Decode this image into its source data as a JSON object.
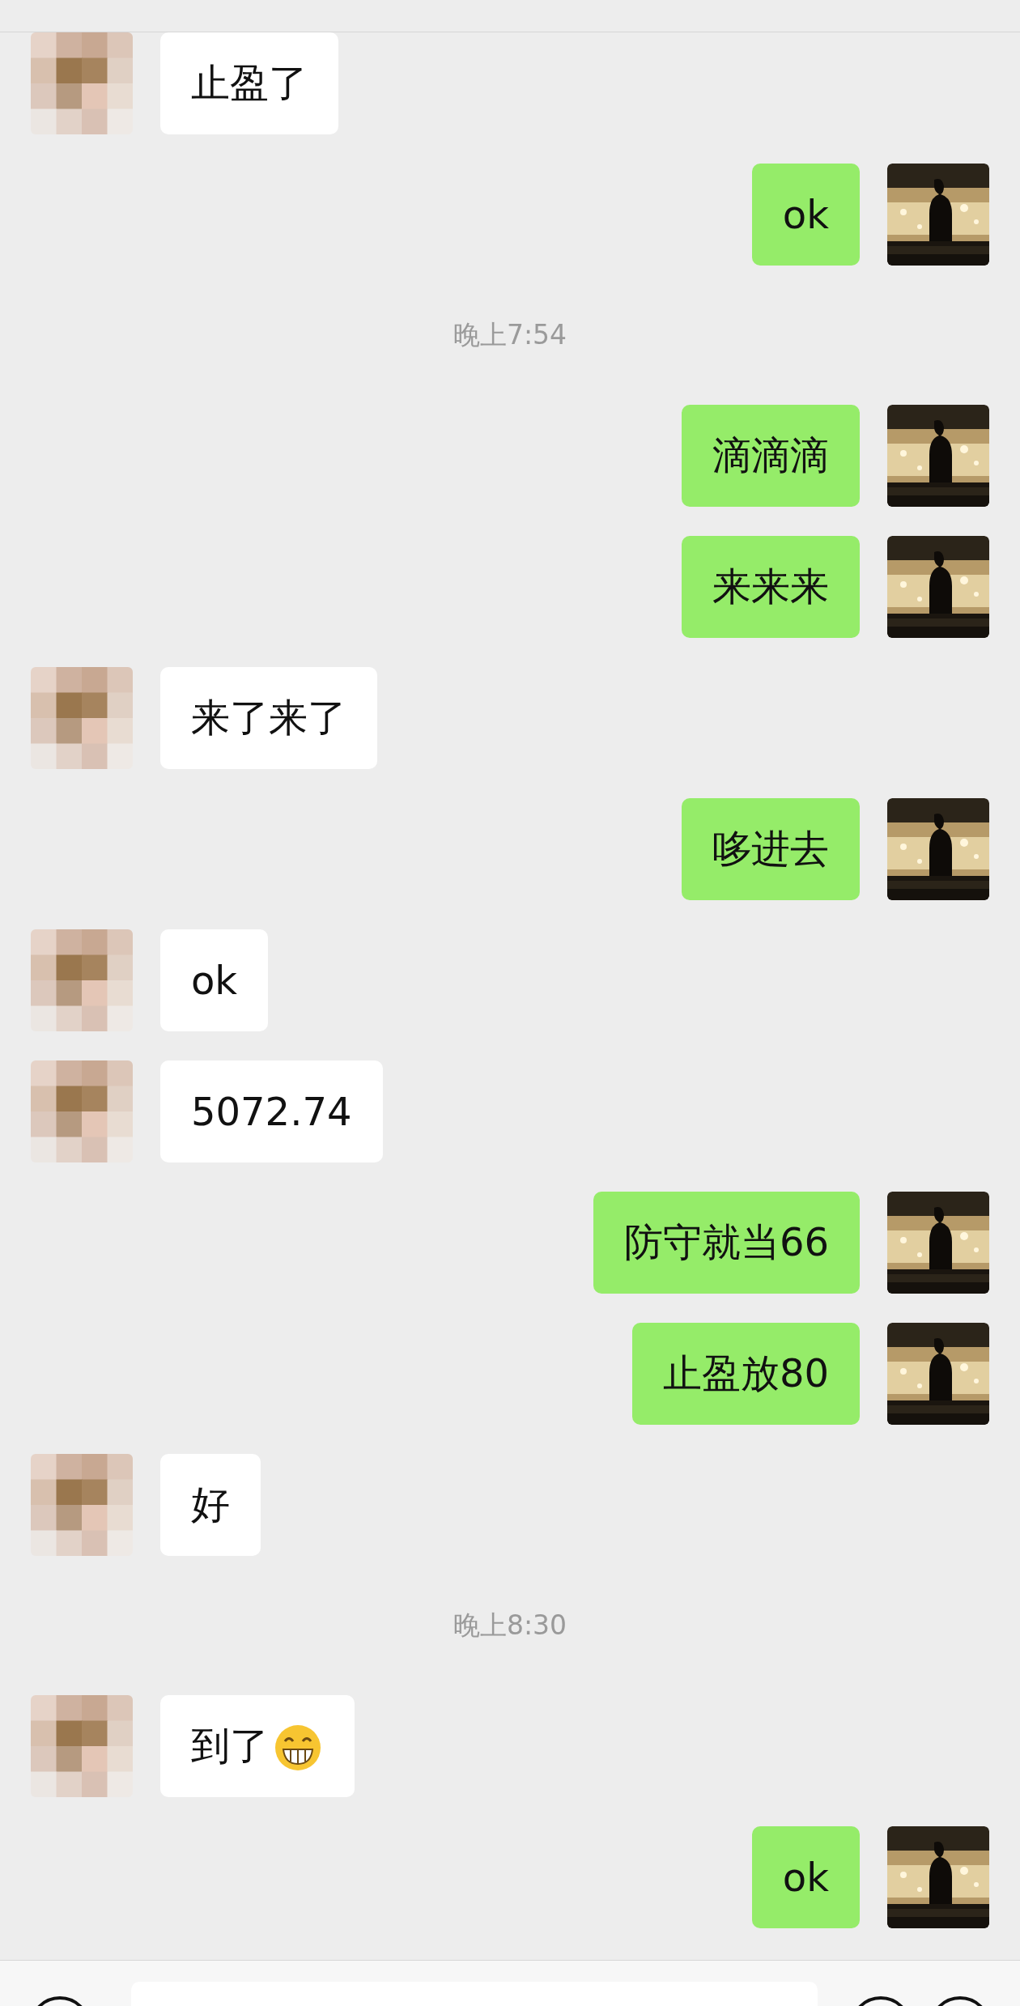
{
  "messages": [
    {
      "kind": "received",
      "text": "止盈了"
    },
    {
      "kind": "sent",
      "text": "ok"
    },
    {
      "kind": "time",
      "text": "晚上7:54"
    },
    {
      "kind": "sent",
      "text": "滴滴滴"
    },
    {
      "kind": "sent",
      "text": "来来来"
    },
    {
      "kind": "received",
      "text": "来了来了"
    },
    {
      "kind": "sent",
      "text": "哆进去"
    },
    {
      "kind": "received",
      "text": "ok"
    },
    {
      "kind": "received",
      "text": "5072.74"
    },
    {
      "kind": "sent",
      "text": "防守就当66"
    },
    {
      "kind": "sent",
      "text": "止盈放80"
    },
    {
      "kind": "received",
      "text": "好"
    },
    {
      "kind": "time",
      "text": "晚上8:30"
    },
    {
      "kind": "received",
      "text": "到了",
      "emoji": true
    },
    {
      "kind": "sent",
      "text": "ok"
    }
  ]
}
